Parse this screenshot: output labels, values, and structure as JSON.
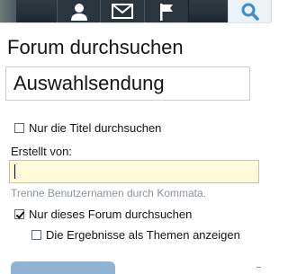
{
  "nav": {
    "icons": [
      "user-icon",
      "mail-icon",
      "flag-icon",
      "search-icon"
    ],
    "accent": "#2f3b45",
    "active": "search-icon"
  },
  "panel": {
    "title": "Forum durchsuchen",
    "search_value": "Auswahlsendung",
    "titles_only_label": "Nur die Titel durchsuchen",
    "titles_only_checked": false,
    "created_by_label": "Erstellt von:",
    "created_by_value": "",
    "hint": "Trenne Benutzernamen durch Kommata.",
    "this_forum_label": "Nur dieses Forum durchsuchen",
    "this_forum_checked": true,
    "as_threads_label": "Die Ergebnisse als Themen anzeigen",
    "as_threads_checked": false
  }
}
